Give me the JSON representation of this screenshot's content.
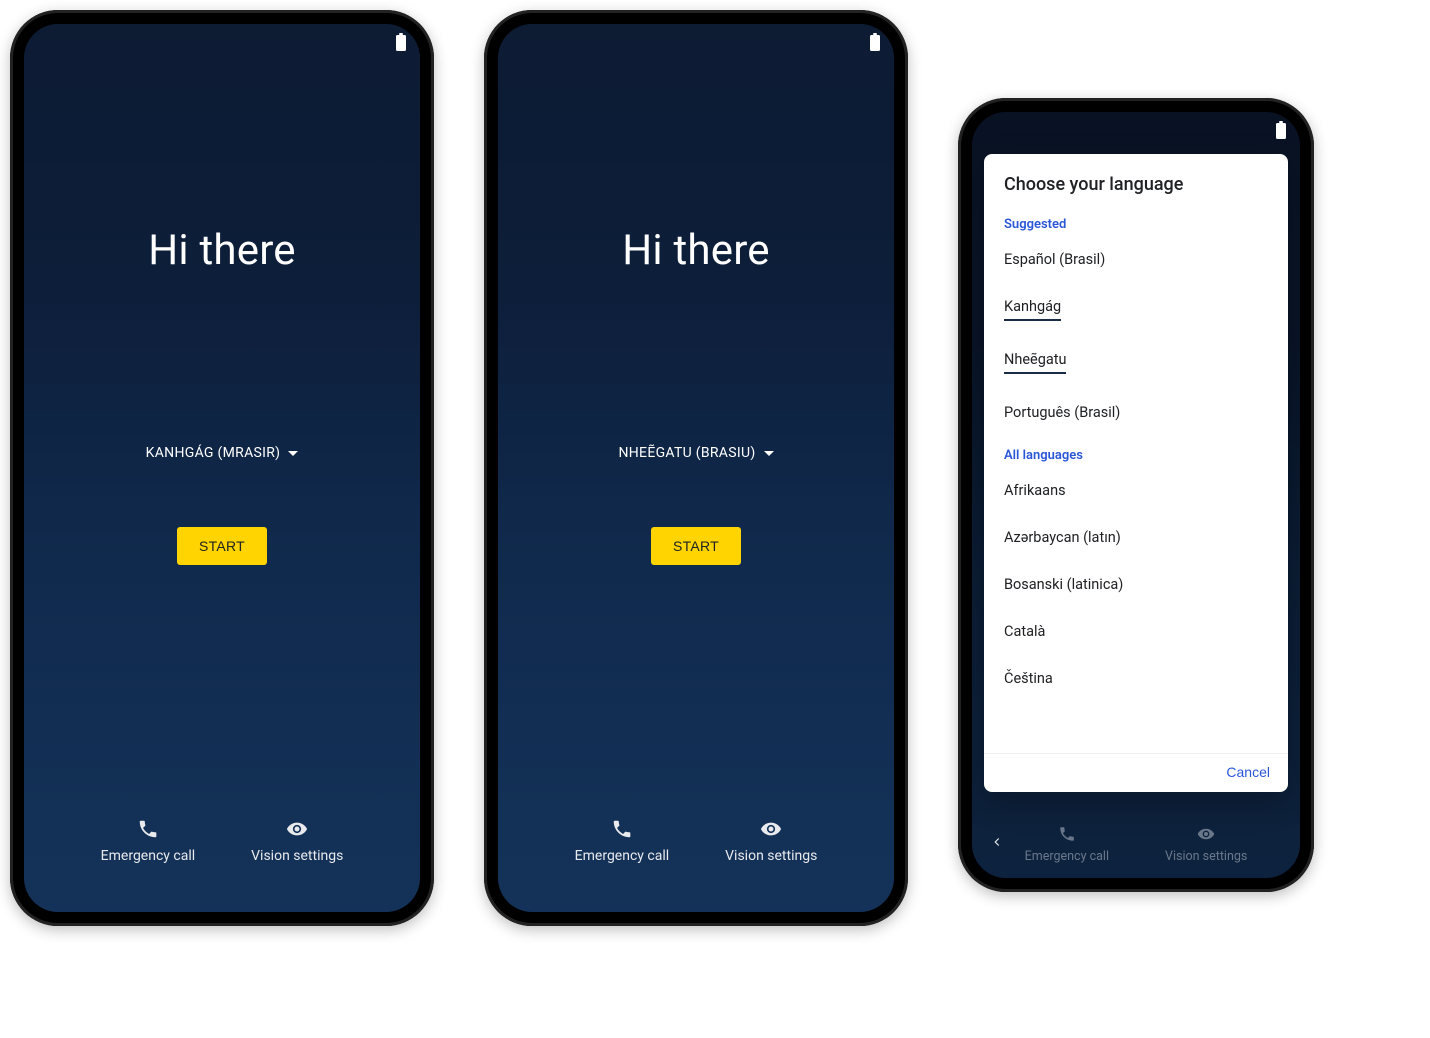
{
  "phones": [
    {
      "greeting": "Hi there",
      "language": "KANHGÁG (MRASIR)",
      "start_label": "START",
      "emergency_label": "Emergency call",
      "vision_label": "Vision settings"
    },
    {
      "greeting": "Hi there",
      "language": "NHEẼGATU (BRASIU)",
      "start_label": "START",
      "emergency_label": "Emergency call",
      "vision_label": "Vision settings"
    }
  ],
  "dialog": {
    "title": "Choose your language",
    "suggested_header": "Suggested",
    "all_header": "All languages",
    "cancel_label": "Cancel",
    "suggested": [
      "Español (Brasil)",
      "Kanhgág",
      "Nheẽgatu",
      "Português (Brasil)"
    ],
    "all": [
      "Afrikaans",
      "Azərbaycan (latın)",
      "Bosanski (latinica)",
      "Català",
      "Čeština"
    ],
    "emergency_label": "Emergency call",
    "vision_label": "Vision settings"
  }
}
